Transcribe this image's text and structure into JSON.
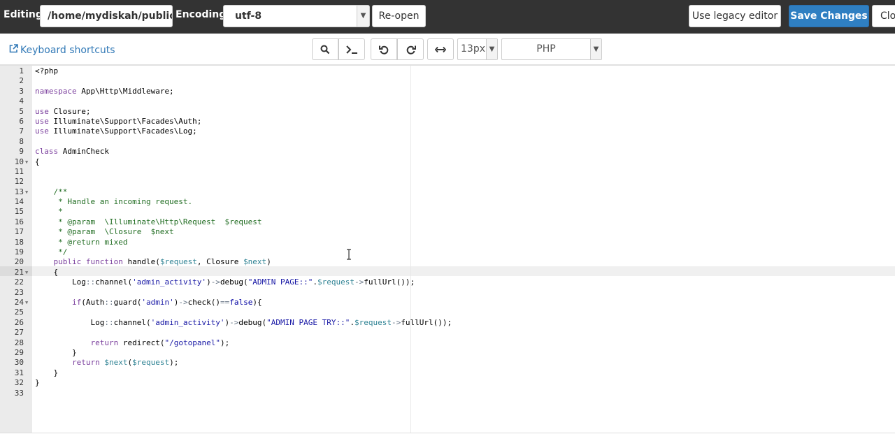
{
  "header": {
    "editing_label": "Editing:",
    "path_value": "/home/mydiskah/public",
    "encoding_label": "Encoding:",
    "encoding_value": "utf-8",
    "reopen_label": "Re-open",
    "legacy_label": "Use legacy editor",
    "save_label": "Save Changes",
    "close_label": "Clo",
    "save_color": "#2f7fc2"
  },
  "toolbar": {
    "shortcuts_label": "Keyboard shortcuts",
    "font_size": "13px",
    "mode": "PHP",
    "icons": [
      "search-icon",
      "terminal-icon",
      "undo-icon",
      "redo-icon",
      "wrap-icon"
    ]
  },
  "code_lines": [
    {
      "n": "1",
      "t": "<?php"
    },
    {
      "n": "2",
      "t": ""
    },
    {
      "n": "3",
      "t": "namespace App\\Http\\Middleware;"
    },
    {
      "n": "4",
      "t": ""
    },
    {
      "n": "5",
      "t": "use Closure;"
    },
    {
      "n": "6",
      "t": "use Illuminate\\Support\\Facades\\Auth;"
    },
    {
      "n": "7",
      "t": "use Illuminate\\Support\\Facades\\Log;"
    },
    {
      "n": "8",
      "t": ""
    },
    {
      "n": "9",
      "t": "class AdminCheck"
    },
    {
      "n": "10",
      "t": "{"
    },
    {
      "n": "11",
      "t": ""
    },
    {
      "n": "12",
      "t": ""
    },
    {
      "n": "13",
      "t": "    /**"
    },
    {
      "n": "14",
      "t": "     * Handle an incoming request."
    },
    {
      "n": "15",
      "t": "     *"
    },
    {
      "n": "16",
      "t": "     * @param  \\Illuminate\\Http\\Request  $request"
    },
    {
      "n": "17",
      "t": "     * @param  \\Closure  $next"
    },
    {
      "n": "18",
      "t": "     * @return mixed"
    },
    {
      "n": "19",
      "t": "     */"
    },
    {
      "n": "20",
      "t": "    public function handle($request, Closure $next)"
    },
    {
      "n": "21",
      "t": "    {"
    },
    {
      "n": "22",
      "t": "        Log::channel('admin_activity')->debug(\"ADMIN PAGE::\".$request->fullUrl());"
    },
    {
      "n": "23",
      "t": ""
    },
    {
      "n": "24",
      "t": "        if(Auth::guard('admin')->check()==false){"
    },
    {
      "n": "25",
      "t": ""
    },
    {
      "n": "26",
      "t": "            Log::channel('admin_activity')->debug(\"ADMIN PAGE TRY::\".$request->fullUrl());"
    },
    {
      "n": "27",
      "t": ""
    },
    {
      "n": "28",
      "t": "            return redirect(\"/gotopanel\");"
    },
    {
      "n": "29",
      "t": "        }"
    },
    {
      "n": "30",
      "t": "        return $next($request);"
    },
    {
      "n": "31",
      "t": "    }"
    },
    {
      "n": "32",
      "t": "}"
    },
    {
      "n": "33",
      "t": ""
    }
  ],
  "fold_lines": [
    "10",
    "13",
    "21",
    "24"
  ],
  "active_line": "21"
}
